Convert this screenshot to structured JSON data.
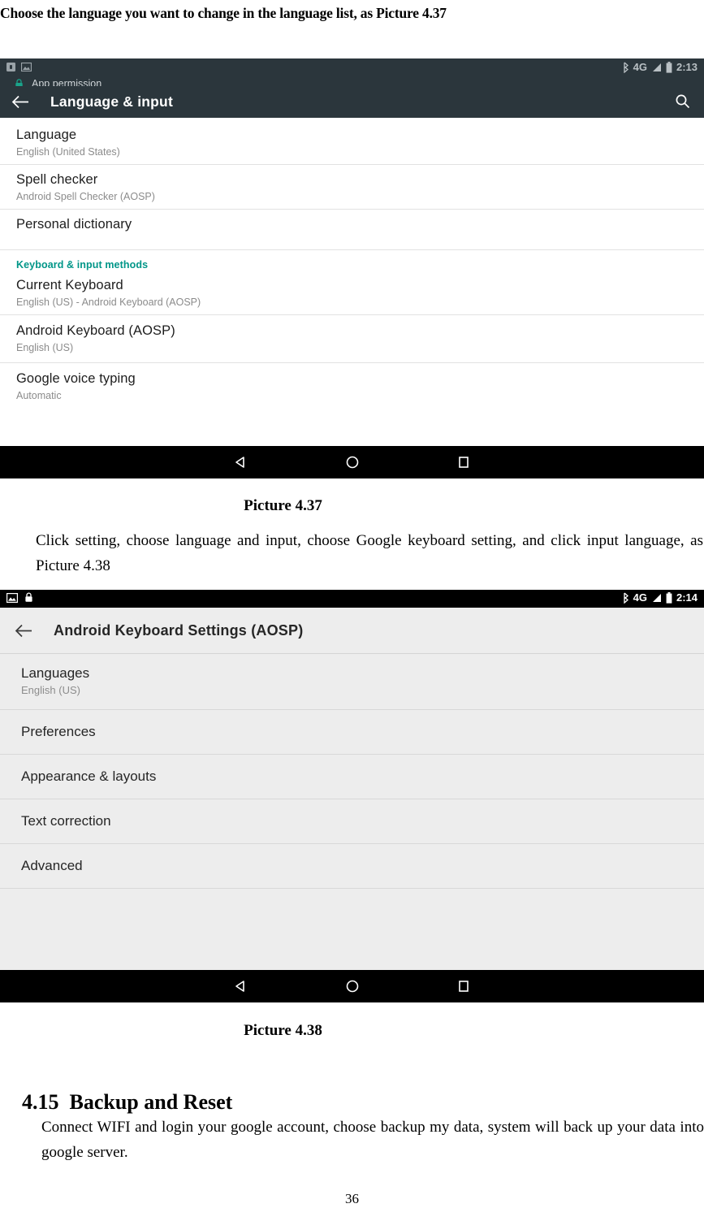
{
  "document": {
    "intro_line": "Choose the language you want to change in the language list, as Picture 4.37",
    "caption_1": "Picture 4.37",
    "paragraph_1": "Click setting, choose language and input, choose Google keyboard setting, and click input language, as Picture 4.38",
    "caption_2": "Picture 4.38",
    "section_number": "4.15",
    "section_title": "Backup and Reset",
    "paragraph_2": "Connect WIFI and login your google account, choose backup my data, system will back up your data into google server.",
    "page_number": "36"
  },
  "screenshot_1": {
    "status_bar": {
      "time": "2:13",
      "network": "4G",
      "icons_left": [
        "sim-card-icon",
        "image-icon"
      ],
      "icons_right": [
        "bluetooth-icon",
        "signal-icon",
        "battery-icon"
      ]
    },
    "notification": {
      "icon": "lock-icon",
      "text": "App permission",
      "icon_color": "#1aa38a"
    },
    "app_bar": {
      "back_label": "←",
      "title": "Language & input",
      "search_icon": "search-icon",
      "background": "#2b363c"
    },
    "rows": [
      {
        "title": "Language",
        "subtitle": "English (United States)"
      },
      {
        "title": "Spell checker",
        "subtitle": "Android Spell Checker (AOSP)"
      },
      {
        "title": "Personal dictionary",
        "subtitle": ""
      }
    ],
    "section_label": "Keyboard & input methods",
    "section_label_color": "#009688",
    "rows2": [
      {
        "title": "Current Keyboard",
        "subtitle": "English (US) - Android Keyboard (AOSP)"
      },
      {
        "title": "Android Keyboard (AOSP)",
        "subtitle": "English (US)"
      },
      {
        "title": "Google voice typing",
        "subtitle": "Automatic"
      }
    ],
    "nav_bar": {
      "back": "back-icon",
      "home": "home-icon",
      "recents": "recents-icon"
    }
  },
  "screenshot_2": {
    "status_bar": {
      "time": "2:14",
      "network": "4G",
      "icons_left": [
        "image-icon",
        "lock-icon"
      ],
      "icons_right": [
        "bluetooth-icon",
        "signal-icon",
        "battery-icon"
      ]
    },
    "app_bar": {
      "back_label": "←",
      "title": "Android Keyboard Settings (AOSP)",
      "background": "#ededed"
    },
    "rows": [
      {
        "title": "Languages",
        "subtitle": "English (US)"
      },
      {
        "title": "Preferences",
        "subtitle": ""
      },
      {
        "title": "Appearance & layouts",
        "subtitle": ""
      },
      {
        "title": "Text correction",
        "subtitle": ""
      },
      {
        "title": "Advanced",
        "subtitle": ""
      }
    ],
    "nav_bar": {
      "back": "back-icon",
      "home": "home-icon",
      "recents": "recents-icon"
    }
  }
}
